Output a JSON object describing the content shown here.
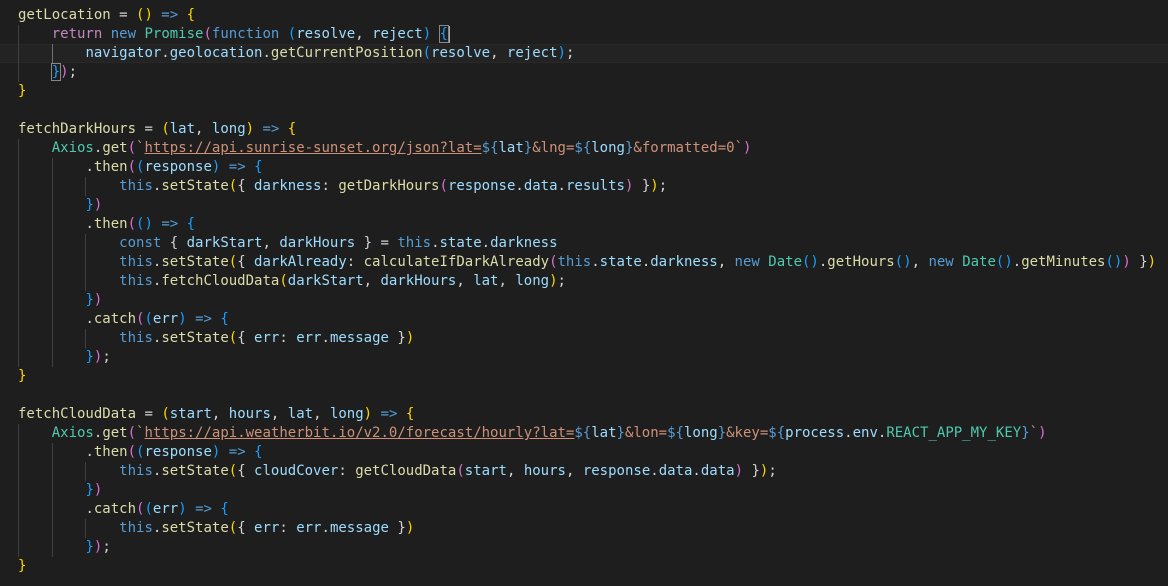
{
  "editor": {
    "language": "javascript",
    "current_line": 2,
    "lines": [
      {
        "indent": 0,
        "tokens": [
          [
            "getLocation",
            "fn"
          ],
          [
            " = ",
            "pn"
          ],
          [
            "()",
            "p1"
          ],
          [
            " => ",
            "kw"
          ],
          [
            "{",
            "p1"
          ]
        ]
      },
      {
        "indent": 1,
        "tokens": [
          [
            "return",
            "kw2"
          ],
          [
            " ",
            "pn"
          ],
          [
            "new",
            "kw"
          ],
          [
            " ",
            "pn"
          ],
          [
            "Promise",
            "cls"
          ],
          [
            "(",
            "p2"
          ],
          [
            "function",
            "kw"
          ],
          [
            " ",
            "pn"
          ],
          [
            "(",
            "p3"
          ],
          [
            "resolve",
            "var"
          ],
          [
            ", ",
            "pn"
          ],
          [
            "reject",
            "var"
          ],
          [
            ")",
            "p3"
          ],
          [
            " ",
            "pn"
          ],
          [
            "{",
            "p3",
            "bm"
          ]
        ]
      },
      {
        "indent": 2,
        "tokens": [
          [
            "navigator",
            "var"
          ],
          [
            ".",
            "pn"
          ],
          [
            "geolocation",
            "var"
          ],
          [
            ".",
            "pn"
          ],
          [
            "getCurrentPosition",
            "fn"
          ],
          [
            "(",
            "p3"
          ],
          [
            "resolve",
            "var"
          ],
          [
            ", ",
            "pn"
          ],
          [
            "reject",
            "var"
          ],
          [
            ")",
            "p3"
          ],
          [
            ";",
            "pn"
          ]
        ]
      },
      {
        "indent": 1,
        "tokens": [
          [
            "}",
            "p3",
            "bm"
          ],
          [
            ")",
            "p2"
          ],
          [
            ";",
            "pn"
          ]
        ]
      },
      {
        "indent": 0,
        "tokens": [
          [
            "}",
            "p1"
          ]
        ]
      },
      {
        "indent": 0,
        "tokens": []
      },
      {
        "indent": 0,
        "tokens": [
          [
            "fetchDarkHours",
            "fn"
          ],
          [
            " = ",
            "pn"
          ],
          [
            "(",
            "p1"
          ],
          [
            "lat",
            "var"
          ],
          [
            ", ",
            "pn"
          ],
          [
            "long",
            "var"
          ],
          [
            ")",
            "p1"
          ],
          [
            " => ",
            "kw"
          ],
          [
            "{",
            "p1"
          ]
        ]
      },
      {
        "indent": 1,
        "tokens": [
          [
            "Axios",
            "cls"
          ],
          [
            ".",
            "pn"
          ],
          [
            "get",
            "fn"
          ],
          [
            "(",
            "p2"
          ],
          [
            "`",
            "str"
          ],
          [
            "https://api.sunrise-sunset.org/json?lat=",
            "url"
          ],
          [
            "${",
            "tmpl"
          ],
          [
            "lat",
            "var"
          ],
          [
            "}",
            "tmpl"
          ],
          [
            "&lng=",
            "str"
          ],
          [
            "${",
            "tmpl"
          ],
          [
            "long",
            "var"
          ],
          [
            "}",
            "tmpl"
          ],
          [
            "&formatted=0",
            "str"
          ],
          [
            "`",
            "str"
          ],
          [
            ")",
            "p2"
          ]
        ]
      },
      {
        "indent": 2,
        "tokens": [
          [
            ".",
            "pn"
          ],
          [
            "then",
            "fn"
          ],
          [
            "(",
            "p2"
          ],
          [
            "(",
            "p3"
          ],
          [
            "response",
            "var"
          ],
          [
            ")",
            "p3"
          ],
          [
            " => ",
            "kw"
          ],
          [
            "{",
            "p3"
          ]
        ]
      },
      {
        "indent": 3,
        "tokens": [
          [
            "this",
            "kw"
          ],
          [
            ".",
            "pn"
          ],
          [
            "setState",
            "fn"
          ],
          [
            "(",
            "p1"
          ],
          [
            "{ ",
            "pn"
          ],
          [
            "darkness",
            "var"
          ],
          [
            ": ",
            "pn"
          ],
          [
            "getDarkHours",
            "fn"
          ],
          [
            "(",
            "p2"
          ],
          [
            "response",
            "var"
          ],
          [
            ".",
            "pn"
          ],
          [
            "data",
            "var"
          ],
          [
            ".",
            "pn"
          ],
          [
            "results",
            "var"
          ],
          [
            ")",
            "p2"
          ],
          [
            " }",
            "pn"
          ],
          [
            ")",
            "p1"
          ],
          [
            ";",
            "pn"
          ]
        ]
      },
      {
        "indent": 2,
        "tokens": [
          [
            "}",
            "p3"
          ],
          [
            ")",
            "p2"
          ]
        ]
      },
      {
        "indent": 2,
        "tokens": [
          [
            ".",
            "pn"
          ],
          [
            "then",
            "fn"
          ],
          [
            "(",
            "p2"
          ],
          [
            "()",
            "p3"
          ],
          [
            " => ",
            "kw"
          ],
          [
            "{",
            "p3"
          ]
        ]
      },
      {
        "indent": 3,
        "tokens": [
          [
            "const",
            "kw"
          ],
          [
            " { ",
            "pn"
          ],
          [
            "darkStart",
            "var"
          ],
          [
            ", ",
            "pn"
          ],
          [
            "darkHours",
            "var"
          ],
          [
            " } = ",
            "pn"
          ],
          [
            "this",
            "kw"
          ],
          [
            ".",
            "pn"
          ],
          [
            "state",
            "var"
          ],
          [
            ".",
            "pn"
          ],
          [
            "darkness",
            "var"
          ]
        ]
      },
      {
        "indent": 3,
        "tokens": [
          [
            "this",
            "kw"
          ],
          [
            ".",
            "pn"
          ],
          [
            "setState",
            "fn"
          ],
          [
            "(",
            "p1"
          ],
          [
            "{ ",
            "pn"
          ],
          [
            "darkAlready",
            "var"
          ],
          [
            ": ",
            "pn"
          ],
          [
            "calculateIfDarkAlready",
            "fn"
          ],
          [
            "(",
            "p2"
          ],
          [
            "this",
            "kw"
          ],
          [
            ".",
            "pn"
          ],
          [
            "state",
            "var"
          ],
          [
            ".",
            "pn"
          ],
          [
            "darkness",
            "var"
          ],
          [
            ", ",
            "pn"
          ],
          [
            "new",
            "kw"
          ],
          [
            " ",
            "pn"
          ],
          [
            "Date",
            "cls"
          ],
          [
            "()",
            "p3"
          ],
          [
            ".",
            "pn"
          ],
          [
            "getHours",
            "fn"
          ],
          [
            "()",
            "p3"
          ],
          [
            ", ",
            "pn"
          ],
          [
            "new",
            "kw"
          ],
          [
            " ",
            "pn"
          ],
          [
            "Date",
            "cls"
          ],
          [
            "()",
            "p3"
          ],
          [
            ".",
            "pn"
          ],
          [
            "getMinutes",
            "fn"
          ],
          [
            "()",
            "p3"
          ],
          [
            ")",
            "p2"
          ],
          [
            " }",
            "pn"
          ],
          [
            ")",
            "p1"
          ]
        ]
      },
      {
        "indent": 3,
        "tokens": [
          [
            "this",
            "kw"
          ],
          [
            ".",
            "pn"
          ],
          [
            "fetchCloudData",
            "fn"
          ],
          [
            "(",
            "p1"
          ],
          [
            "darkStart",
            "var"
          ],
          [
            ", ",
            "pn"
          ],
          [
            "darkHours",
            "var"
          ],
          [
            ", ",
            "pn"
          ],
          [
            "lat",
            "var"
          ],
          [
            ", ",
            "pn"
          ],
          [
            "long",
            "var"
          ],
          [
            ")",
            "p1"
          ],
          [
            ";",
            "pn"
          ]
        ]
      },
      {
        "indent": 2,
        "tokens": [
          [
            "}",
            "p3"
          ],
          [
            ")",
            "p2"
          ]
        ]
      },
      {
        "indent": 2,
        "tokens": [
          [
            ".",
            "pn"
          ],
          [
            "catch",
            "fn"
          ],
          [
            "(",
            "p2"
          ],
          [
            "(",
            "p3"
          ],
          [
            "err",
            "var"
          ],
          [
            ")",
            "p3"
          ],
          [
            " => ",
            "kw"
          ],
          [
            "{",
            "p3"
          ]
        ]
      },
      {
        "indent": 3,
        "tokens": [
          [
            "this",
            "kw"
          ],
          [
            ".",
            "pn"
          ],
          [
            "setState",
            "fn"
          ],
          [
            "(",
            "p1"
          ],
          [
            "{ ",
            "pn"
          ],
          [
            "err",
            "var"
          ],
          [
            ": ",
            "pn"
          ],
          [
            "err",
            "var"
          ],
          [
            ".",
            "pn"
          ],
          [
            "message",
            "var"
          ],
          [
            " }",
            "pn"
          ],
          [
            ")",
            "p1"
          ]
        ]
      },
      {
        "indent": 2,
        "tokens": [
          [
            "}",
            "p3"
          ],
          [
            ")",
            "p2"
          ],
          [
            ";",
            "pn"
          ]
        ]
      },
      {
        "indent": 0,
        "tokens": [
          [
            "}",
            "p1"
          ]
        ]
      },
      {
        "indent": 0,
        "tokens": []
      },
      {
        "indent": 0,
        "tokens": [
          [
            "fetchCloudData",
            "fn"
          ],
          [
            " = ",
            "pn"
          ],
          [
            "(",
            "p1"
          ],
          [
            "start",
            "var"
          ],
          [
            ", ",
            "pn"
          ],
          [
            "hours",
            "var"
          ],
          [
            ", ",
            "pn"
          ],
          [
            "lat",
            "var"
          ],
          [
            ", ",
            "pn"
          ],
          [
            "long",
            "var"
          ],
          [
            ")",
            "p1"
          ],
          [
            " => ",
            "kw"
          ],
          [
            "{",
            "p1"
          ]
        ]
      },
      {
        "indent": 1,
        "tokens": [
          [
            "Axios",
            "cls"
          ],
          [
            ".",
            "pn"
          ],
          [
            "get",
            "fn"
          ],
          [
            "(",
            "p2"
          ],
          [
            "`",
            "str"
          ],
          [
            "https://api.weatherbit.io/v2.0/forecast/hourly?lat=",
            "url"
          ],
          [
            "${",
            "tmpl"
          ],
          [
            "lat",
            "var"
          ],
          [
            "}",
            "tmpl"
          ],
          [
            "&lon=",
            "str"
          ],
          [
            "${",
            "tmpl"
          ],
          [
            "long",
            "var"
          ],
          [
            "}",
            "tmpl"
          ],
          [
            "&key=",
            "str"
          ],
          [
            "${",
            "tmpl"
          ],
          [
            "process",
            "var"
          ],
          [
            ".",
            "pn"
          ],
          [
            "env",
            "var"
          ],
          [
            ".",
            "pn"
          ],
          [
            "REACT_APP_MY_KEY",
            "cls"
          ],
          [
            "}",
            "tmpl"
          ],
          [
            "`",
            "str"
          ],
          [
            ")",
            "p2"
          ]
        ]
      },
      {
        "indent": 2,
        "tokens": [
          [
            ".",
            "pn"
          ],
          [
            "then",
            "fn"
          ],
          [
            "(",
            "p2"
          ],
          [
            "(",
            "p3"
          ],
          [
            "response",
            "var"
          ],
          [
            ")",
            "p3"
          ],
          [
            " => ",
            "kw"
          ],
          [
            "{",
            "p3"
          ]
        ]
      },
      {
        "indent": 3,
        "tokens": [
          [
            "this",
            "kw"
          ],
          [
            ".",
            "pn"
          ],
          [
            "setState",
            "fn"
          ],
          [
            "(",
            "p1"
          ],
          [
            "{ ",
            "pn"
          ],
          [
            "cloudCover",
            "var"
          ],
          [
            ": ",
            "pn"
          ],
          [
            "getCloudData",
            "fn"
          ],
          [
            "(",
            "p2"
          ],
          [
            "start",
            "var"
          ],
          [
            ", ",
            "pn"
          ],
          [
            "hours",
            "var"
          ],
          [
            ", ",
            "pn"
          ],
          [
            "response",
            "var"
          ],
          [
            ".",
            "pn"
          ],
          [
            "data",
            "var"
          ],
          [
            ".",
            "pn"
          ],
          [
            "data",
            "var"
          ],
          [
            ")",
            "p2"
          ],
          [
            " }",
            "pn"
          ],
          [
            ")",
            "p1"
          ],
          [
            ";",
            "pn"
          ]
        ]
      },
      {
        "indent": 2,
        "tokens": [
          [
            "}",
            "p3"
          ],
          [
            ")",
            "p2"
          ]
        ]
      },
      {
        "indent": 2,
        "tokens": [
          [
            ".",
            "pn"
          ],
          [
            "catch",
            "fn"
          ],
          [
            "(",
            "p2"
          ],
          [
            "(",
            "p3"
          ],
          [
            "err",
            "var"
          ],
          [
            ")",
            "p3"
          ],
          [
            " => ",
            "kw"
          ],
          [
            "{",
            "p3"
          ]
        ]
      },
      {
        "indent": 3,
        "tokens": [
          [
            "this",
            "kw"
          ],
          [
            ".",
            "pn"
          ],
          [
            "setState",
            "fn"
          ],
          [
            "(",
            "p1"
          ],
          [
            "{ ",
            "pn"
          ],
          [
            "err",
            "var"
          ],
          [
            ": ",
            "pn"
          ],
          [
            "err",
            "var"
          ],
          [
            ".",
            "pn"
          ],
          [
            "message",
            "var"
          ],
          [
            " }",
            "pn"
          ],
          [
            ")",
            "p1"
          ]
        ]
      },
      {
        "indent": 2,
        "tokens": [
          [
            "}",
            "p3"
          ],
          [
            ")",
            "p2"
          ],
          [
            ";",
            "pn"
          ]
        ]
      },
      {
        "indent": 0,
        "tokens": [
          [
            "}",
            "p1"
          ]
        ]
      }
    ]
  },
  "colors": {
    "background": "#1e1e1e",
    "keyword": "#569cd6",
    "control_keyword": "#c586c0",
    "function": "#dcdcaa",
    "variable": "#9cdcfe",
    "class": "#4ec9b0",
    "string": "#ce9178",
    "bracket_level_1": "#ffd700",
    "bracket_level_2": "#da70d6",
    "bracket_level_3": "#179fff"
  }
}
